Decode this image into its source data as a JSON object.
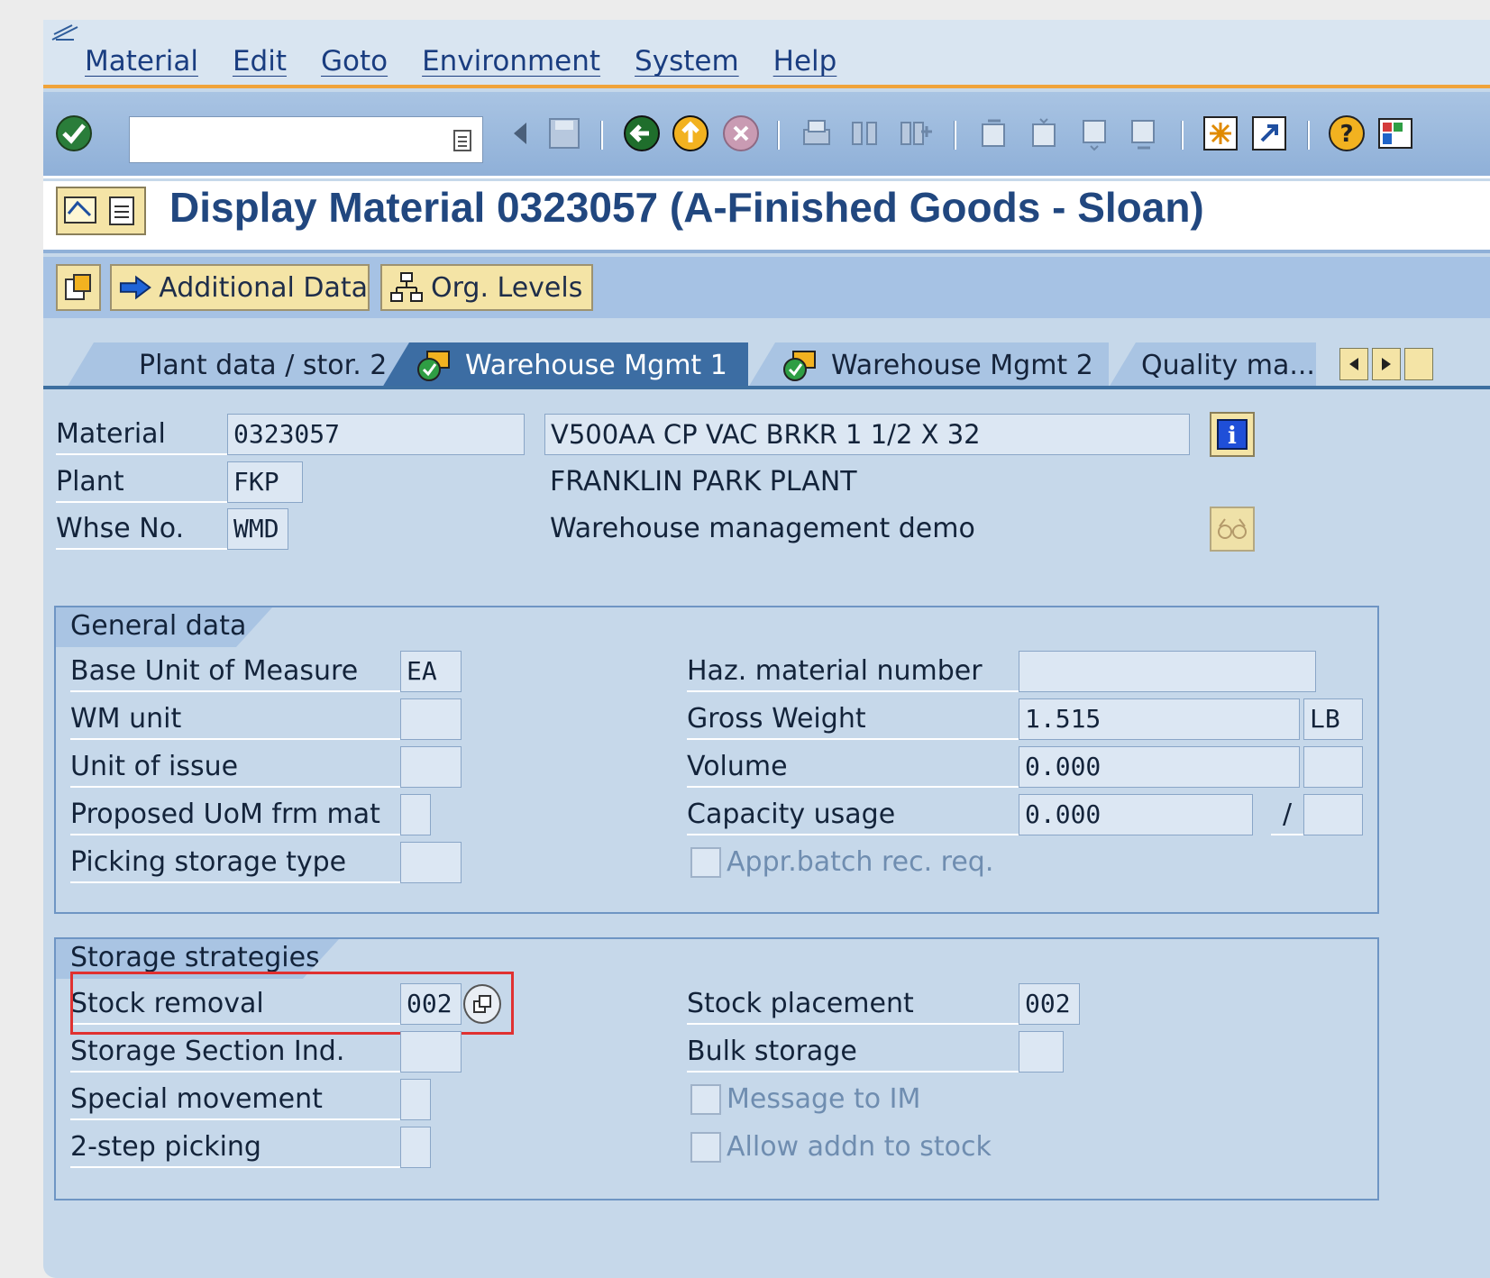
{
  "menu": [
    "Material",
    "Edit",
    "Goto",
    "Environment",
    "System",
    "Help"
  ],
  "title": "Display Material 0323057 (A-Finished Goods - Sloan)",
  "app_toolbar": {
    "additional_data": "Additional Data",
    "org_levels": "Org. Levels"
  },
  "tabs": [
    {
      "label": "Plant data / stor. 2",
      "active": false
    },
    {
      "label": "Warehouse Mgmt 1",
      "active": true
    },
    {
      "label": "Warehouse Mgmt 2",
      "active": false
    },
    {
      "label": "Quality ma...",
      "active": false
    }
  ],
  "header": {
    "material_label": "Material",
    "material": "0323057",
    "material_desc": "V500AA CP VAC BRKR 1 1/2 X 32",
    "plant_label": "Plant",
    "plant": "FKP",
    "plant_desc": "FRANKLIN PARK PLANT",
    "whse_label": "Whse No.",
    "whse": "WMD",
    "whse_desc": "Warehouse management demo"
  },
  "general": {
    "title": "General data",
    "base_uom_label": "Base Unit of Measure",
    "base_uom": "EA",
    "wm_unit_label": "WM unit",
    "wm_unit": "",
    "unit_issue_label": "Unit of issue",
    "unit_issue": "",
    "prop_uom_label": "Proposed UoM frm mat",
    "prop_uom": "",
    "pick_stype_label": "Picking storage type",
    "pick_stype": "",
    "haz_label": "Haz. material number",
    "haz": "",
    "gross_label": "Gross Weight",
    "gross": "1.515",
    "gross_unit": "LB",
    "volume_label": "Volume",
    "volume": "0.000",
    "volume_unit": "",
    "capacity_label": "Capacity usage",
    "capacity": "0.000",
    "capacity_sep": "/",
    "capacity_unit": "",
    "appr_batch_label": "Appr.batch rec. req."
  },
  "storage": {
    "title": "Storage strategies",
    "stock_removal_label": "Stock removal",
    "stock_removal": "002",
    "section_ind_label": "Storage Section Ind.",
    "section_ind": "",
    "special_mvmt_label": "Special movement",
    "special_mvmt": "",
    "two_step_label": "2-step picking",
    "two_step": "",
    "stock_placement_label": "Stock placement",
    "stock_placement": "002",
    "bulk_label": "Bulk storage",
    "bulk": "",
    "message_im_label": "Message to IM",
    "allow_addn_label": "Allow addn to stock"
  },
  "colors": {
    "title": "#21477f",
    "accent": "#f0a33a",
    "highlight": "#e03131"
  }
}
